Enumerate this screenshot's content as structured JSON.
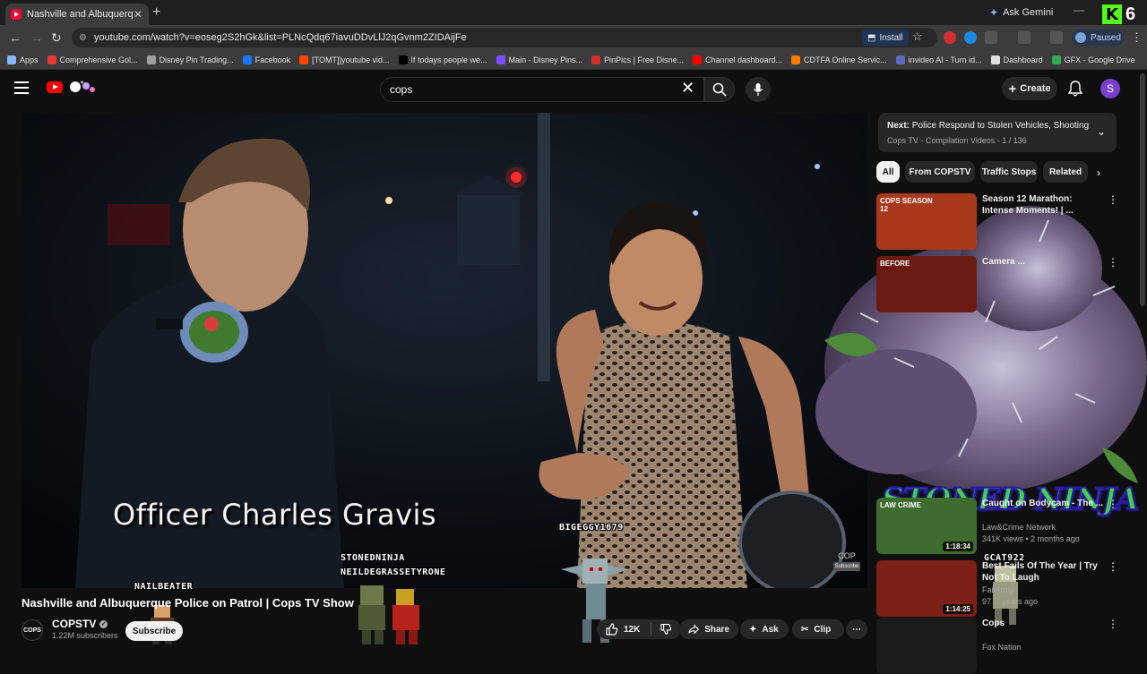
{
  "browser": {
    "tab_title": "Nashville and Albuquerque",
    "gemini_label": "Ask Gemini",
    "url": "youtube.com/watch?v=eoseg2S2hGk&list=PLNcQdq67iavuDDvLlJ2qGvnm2ZIDAijFe",
    "install_label": "Install",
    "profile_status": "Paused",
    "k6_badge": "6",
    "bookmarks": [
      {
        "label": "Apps",
        "color": "#8ab4f8"
      },
      {
        "label": "Comprehensive Gol...",
        "color": "#e53935"
      },
      {
        "label": "Disney Pin Trading...",
        "color": "#9e9e9e"
      },
      {
        "label": "Facebook",
        "color": "#1877f2"
      },
      {
        "label": "[TOMT]]youtube vid...",
        "color": "#ff4500"
      },
      {
        "label": "If todays people we...",
        "color": "#000000"
      },
      {
        "label": "Main - Disney Pins...",
        "color": "#7c4dff"
      },
      {
        "label": "PinPics | Free Disne...",
        "color": "#d32f2f"
      },
      {
        "label": "Channel dashboard...",
        "color": "#ff0000"
      },
      {
        "label": "CDTFA Online Servic...",
        "color": "#f57c00"
      },
      {
        "label": "invideo AI - Turn id...",
        "color": "#5c6bc0"
      },
      {
        "label": "Dashboard",
        "color": "#e0e0e0"
      },
      {
        "label": "GFX - Google Drive",
        "color": "#34a853"
      }
    ]
  },
  "youtube": {
    "search_query": "cops",
    "create_label": "Create",
    "avatar_letter": "S"
  },
  "video": {
    "lower_third": "Officer Charles Gravis",
    "watermark_text": "COP",
    "watermark_sub": "Subscribe",
    "title": "Nashville and Albuquerque Police on Patrol | Cops TV Show",
    "channel_name": "COPSTV",
    "channel_avatar_text": "COPS",
    "subscribers": "1.22M subscribers",
    "subscribe_label": "Subscribe",
    "likes": "12K",
    "share_label": "Share",
    "ask_label": "Ask",
    "clip_label": "Clip"
  },
  "stream_overlay": {
    "labels": [
      {
        "key": "nailbeater",
        "text": "NAILBEATER"
      },
      {
        "key": "stonedninja_user",
        "text": "STONEDNINJA"
      },
      {
        "key": "neildegrass",
        "text": "NEILDEGRASSETYRONE"
      },
      {
        "key": "bigeggy",
        "text": "BIGEGGY1679"
      },
      {
        "key": "gcat",
        "text": "GCAT922"
      }
    ],
    "banner": "STONED NINJA"
  },
  "sidebar": {
    "next_prefix": "Next:",
    "next_title": "Police Respond to Stolen Vehicles, Shootings,...",
    "next_meta": "Cops TV - Compilation Videos - 1 / 136",
    "chips": [
      "All",
      "From COPSTV",
      "Traffic Stops",
      "Related"
    ],
    "recommendations": [
      {
        "title": "Season 12 Marathon: Intense Moments! | ...",
        "channel": "",
        "meta": "",
        "duration": "",
        "thumb_label": "COPS SEASON 12"
      },
      {
        "title": "Camera ...",
        "channel": "",
        "meta": "",
        "duration": "",
        "thumb_label": "BEFORE"
      },
      {
        "title": "Caught on Bodycam - The ...",
        "channel": "Law&Crime Network",
        "meta": "341K views • 2 months ago",
        "duration": "1:18:34",
        "thumb_label": "LAW CRIME"
      },
      {
        "title": "Best Fails Of The Year | Try Not To Laugh",
        "channel": "FailArmy",
        "meta": "97 ... years ago",
        "duration": "1:14:25",
        "thumb_label": ""
      },
      {
        "title": "Cops",
        "channel": "Fox Nation",
        "meta": "",
        "duration": "",
        "thumb_label": ""
      }
    ]
  },
  "colors": {
    "accent_red": "#ff0000",
    "stoned_green": "#3fd24a",
    "stoned_outline": "#2a1aa0"
  }
}
